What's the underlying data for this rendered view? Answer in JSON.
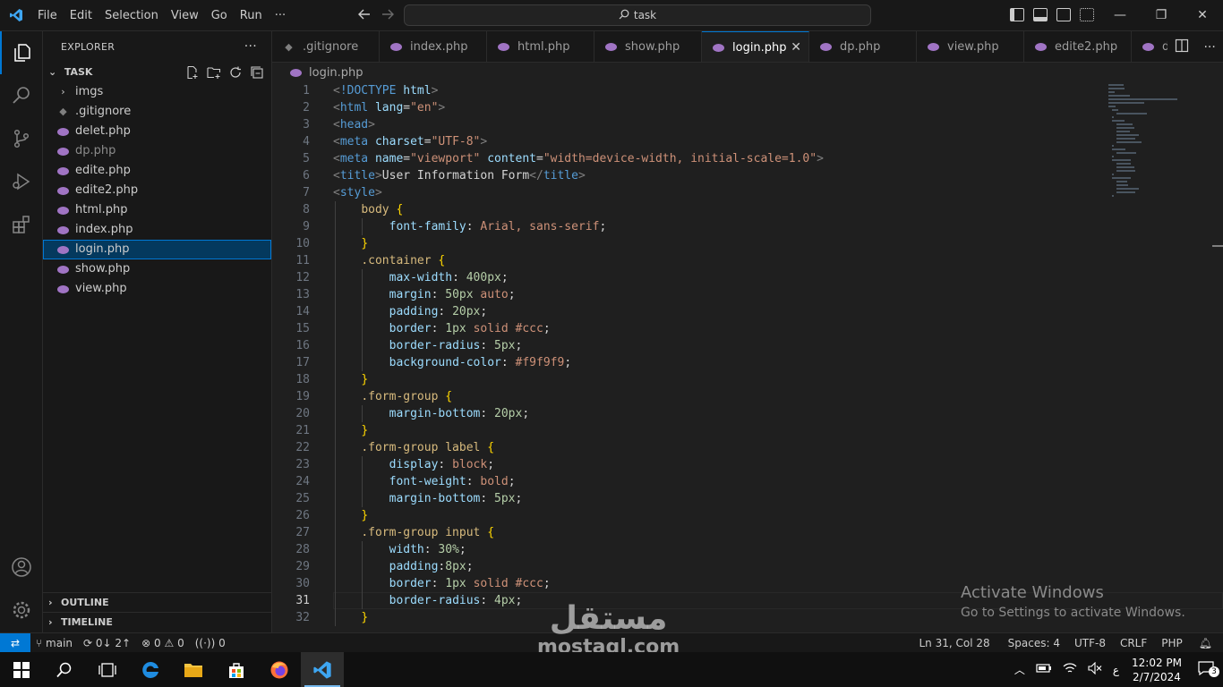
{
  "titlebar": {
    "menu": [
      "File",
      "Edit",
      "Selection",
      "View",
      "Go",
      "Run",
      "···"
    ],
    "search": "task",
    "back_icon": "arrow-left",
    "forward_icon": "arrow-right",
    "minimize": "—",
    "restore": "❐",
    "close": "✕"
  },
  "sidebar": {
    "title": "EXPLORER",
    "more": "···",
    "folder": "TASK",
    "items": [
      {
        "label": "imgs",
        "kind": "folder",
        "dim": false
      },
      {
        "label": ".gitignore",
        "kind": "git",
        "dim": false
      },
      {
        "label": "delet.php",
        "kind": "php",
        "dim": false
      },
      {
        "label": "dp.php",
        "kind": "php",
        "dim": true
      },
      {
        "label": "edite.php",
        "kind": "php",
        "dim": false
      },
      {
        "label": "edite2.php",
        "kind": "php",
        "dim": false
      },
      {
        "label": "html.php",
        "kind": "php",
        "dim": false
      },
      {
        "label": "index.php",
        "kind": "php",
        "dim": false
      },
      {
        "label": "login.php",
        "kind": "php",
        "dim": false,
        "selected": true
      },
      {
        "label": "show.php",
        "kind": "php",
        "dim": false
      },
      {
        "label": "view.php",
        "kind": "php",
        "dim": false
      }
    ],
    "outline": "OUTLINE",
    "timeline": "TIMELINE"
  },
  "tabs": [
    {
      "label": ".gitignore",
      "kind": "git"
    },
    {
      "label": "index.php",
      "kind": "php"
    },
    {
      "label": "html.php",
      "kind": "php"
    },
    {
      "label": "show.php",
      "kind": "php"
    },
    {
      "label": "login.php",
      "kind": "php",
      "active": true
    },
    {
      "label": "dp.php",
      "kind": "php"
    },
    {
      "label": "view.php",
      "kind": "php"
    },
    {
      "label": "edite2.php",
      "kind": "php"
    },
    {
      "label": "d",
      "kind": "php"
    }
  ],
  "breadcrumb": "login.php",
  "code": [
    [
      [
        "t-br",
        "<"
      ],
      [
        "t-tag",
        "!DOCTYPE "
      ],
      [
        "t-attr",
        "html"
      ],
      [
        "t-br",
        ">"
      ]
    ],
    [
      [
        "t-br",
        "<"
      ],
      [
        "t-tag",
        "html "
      ],
      [
        "t-attr",
        "lang"
      ],
      [
        "t-plain",
        "="
      ],
      [
        "t-str",
        "\"en\""
      ],
      [
        "t-br",
        ">"
      ]
    ],
    [
      [
        "t-br",
        "<"
      ],
      [
        "t-tag",
        "head"
      ],
      [
        "t-br",
        ">"
      ]
    ],
    [
      [
        "t-br",
        "<"
      ],
      [
        "t-tag",
        "meta "
      ],
      [
        "t-attr",
        "charset"
      ],
      [
        "t-plain",
        "="
      ],
      [
        "t-str",
        "\"UTF-8\""
      ],
      [
        "t-br",
        ">"
      ]
    ],
    [
      [
        "t-br",
        "<"
      ],
      [
        "t-tag",
        "meta "
      ],
      [
        "t-attr",
        "name"
      ],
      [
        "t-plain",
        "="
      ],
      [
        "t-str",
        "\"viewport\" "
      ],
      [
        "t-attr",
        "content"
      ],
      [
        "t-plain",
        "="
      ],
      [
        "t-str",
        "\"width=device-width, initial-scale=1.0\""
      ],
      [
        "t-br",
        ">"
      ]
    ],
    [
      [
        "t-br",
        "<"
      ],
      [
        "t-tag",
        "title"
      ],
      [
        "t-br",
        ">"
      ],
      [
        "t-plain",
        "User Information Form"
      ],
      [
        "t-br",
        "</"
      ],
      [
        "t-tag",
        "title"
      ],
      [
        "t-br",
        ">"
      ]
    ],
    [
      [
        "t-br",
        "<"
      ],
      [
        "t-tag",
        "style"
      ],
      [
        "t-br",
        ">"
      ]
    ],
    [
      [
        "t-plain",
        "    "
      ],
      [
        "t-sel",
        "body "
      ],
      [
        "t-brace",
        "{"
      ]
    ],
    [
      [
        "t-plain",
        "        "
      ],
      [
        "t-prop",
        "font-family"
      ],
      [
        "t-plain",
        ": "
      ],
      [
        "t-kw",
        "Arial, sans-serif"
      ],
      [
        "t-plain",
        ";"
      ]
    ],
    [
      [
        "t-plain",
        "    "
      ],
      [
        "t-brace",
        "}"
      ]
    ],
    [
      [
        "t-plain",
        "    "
      ],
      [
        "t-sel",
        ".container "
      ],
      [
        "t-brace",
        "{"
      ]
    ],
    [
      [
        "t-plain",
        "        "
      ],
      [
        "t-prop",
        "max-width"
      ],
      [
        "t-plain",
        ": "
      ],
      [
        "t-num",
        "400px"
      ],
      [
        "t-plain",
        ";"
      ]
    ],
    [
      [
        "t-plain",
        "        "
      ],
      [
        "t-prop",
        "margin"
      ],
      [
        "t-plain",
        ": "
      ],
      [
        "t-num",
        "50px "
      ],
      [
        "t-kw",
        "auto"
      ],
      [
        "t-plain",
        ";"
      ]
    ],
    [
      [
        "t-plain",
        "        "
      ],
      [
        "t-prop",
        "padding"
      ],
      [
        "t-plain",
        ": "
      ],
      [
        "t-num",
        "20px"
      ],
      [
        "t-plain",
        ";"
      ]
    ],
    [
      [
        "t-plain",
        "        "
      ],
      [
        "t-prop",
        "border"
      ],
      [
        "t-plain",
        ": "
      ],
      [
        "t-num",
        "1px "
      ],
      [
        "t-kw",
        "solid #ccc"
      ],
      [
        "t-plain",
        ";"
      ]
    ],
    [
      [
        "t-plain",
        "        "
      ],
      [
        "t-prop",
        "border-radius"
      ],
      [
        "t-plain",
        ": "
      ],
      [
        "t-num",
        "5px"
      ],
      [
        "t-plain",
        ";"
      ]
    ],
    [
      [
        "t-plain",
        "        "
      ],
      [
        "t-prop",
        "background-color"
      ],
      [
        "t-plain",
        ": "
      ],
      [
        "t-kw",
        "#f9f9f9"
      ],
      [
        "t-plain",
        ";"
      ]
    ],
    [
      [
        "t-plain",
        "    "
      ],
      [
        "t-brace",
        "}"
      ]
    ],
    [
      [
        "t-plain",
        "    "
      ],
      [
        "t-sel",
        ".form-group "
      ],
      [
        "t-brace",
        "{"
      ]
    ],
    [
      [
        "t-plain",
        "        "
      ],
      [
        "t-prop",
        "margin-bottom"
      ],
      [
        "t-plain",
        ": "
      ],
      [
        "t-num",
        "20px"
      ],
      [
        "t-plain",
        ";"
      ]
    ],
    [
      [
        "t-plain",
        "    "
      ],
      [
        "t-brace",
        "}"
      ]
    ],
    [
      [
        "t-plain",
        "    "
      ],
      [
        "t-sel",
        ".form-group label "
      ],
      [
        "t-brace",
        "{"
      ]
    ],
    [
      [
        "t-plain",
        "        "
      ],
      [
        "t-prop",
        "display"
      ],
      [
        "t-plain",
        ": "
      ],
      [
        "t-kw",
        "block"
      ],
      [
        "t-plain",
        ";"
      ]
    ],
    [
      [
        "t-plain",
        "        "
      ],
      [
        "t-prop",
        "font-weight"
      ],
      [
        "t-plain",
        ": "
      ],
      [
        "t-kw",
        "bold"
      ],
      [
        "t-plain",
        ";"
      ]
    ],
    [
      [
        "t-plain",
        "        "
      ],
      [
        "t-prop",
        "margin-bottom"
      ],
      [
        "t-plain",
        ": "
      ],
      [
        "t-num",
        "5px"
      ],
      [
        "t-plain",
        ";"
      ]
    ],
    [
      [
        "t-plain",
        "    "
      ],
      [
        "t-brace",
        "}"
      ]
    ],
    [
      [
        "t-plain",
        "    "
      ],
      [
        "t-sel",
        ".form-group input "
      ],
      [
        "t-brace",
        "{"
      ]
    ],
    [
      [
        "t-plain",
        "        "
      ],
      [
        "t-prop",
        "width"
      ],
      [
        "t-plain",
        ": "
      ],
      [
        "t-num",
        "30%"
      ],
      [
        "t-plain",
        ";"
      ]
    ],
    [
      [
        "t-plain",
        "        "
      ],
      [
        "t-prop",
        "padding"
      ],
      [
        "t-plain",
        ":"
      ],
      [
        "t-num",
        "8px"
      ],
      [
        "t-plain",
        ";"
      ]
    ],
    [
      [
        "t-plain",
        "        "
      ],
      [
        "t-prop",
        "border"
      ],
      [
        "t-plain",
        ": "
      ],
      [
        "t-num",
        "1px "
      ],
      [
        "t-kw",
        "solid #ccc"
      ],
      [
        "t-plain",
        ";"
      ]
    ],
    [
      [
        "t-plain",
        "        "
      ],
      [
        "t-prop",
        "border-radius"
      ],
      [
        "t-plain",
        ": "
      ],
      [
        "t-num",
        "4px"
      ],
      [
        "t-plain",
        ";"
      ]
    ],
    [
      [
        "t-plain",
        "    "
      ],
      [
        "t-brace",
        "}"
      ]
    ]
  ],
  "current_line": 31,
  "activate": {
    "title": "Activate Windows",
    "subtitle": "Go to Settings to activate Windows."
  },
  "watermark": {
    "arabic": "مستقل",
    "latin": "mostaql.com"
  },
  "statusbar": {
    "remote": "⇄",
    "branch": "main",
    "sync": "0↓ 2↑",
    "errors": "0",
    "warnings": "0",
    "ports": "0",
    "position": "Ln 31, Col 28",
    "spaces": "Spaces: 4",
    "encoding": "UTF-8",
    "eol": "CRLF",
    "language": "PHP"
  },
  "taskbar": {
    "time": "12:02 PM",
    "date": "2/7/2024",
    "lang": "ع",
    "notifications": "3"
  },
  "colors": {
    "accent": "#0078d4",
    "php_icon": "#a074c4"
  }
}
